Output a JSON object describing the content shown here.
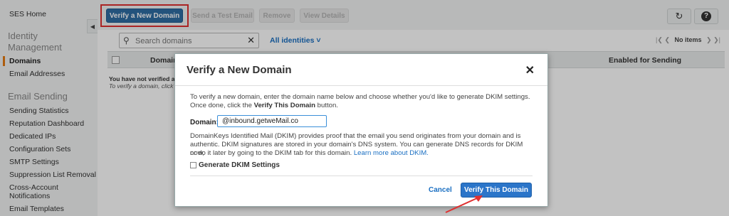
{
  "sidebar": {
    "home": "SES Home",
    "identity_heading_1": "Identity",
    "identity_heading_2": "Management",
    "identity_items": [
      "Domains",
      "Email Addresses"
    ],
    "email_heading": "Email Sending",
    "email_items": [
      "Sending Statistics",
      "Reputation Dashboard",
      "Dedicated IPs",
      "Configuration Sets",
      "SMTP Settings",
      "Suppression List Removal",
      "Cross-Account",
      "Notifications",
      "Email Templates"
    ],
    "collapse_icon": "chevron-left-icon"
  },
  "toolbar": {
    "verify_label": "Verify a New Domain",
    "test_email_label": "Send a Test Email",
    "remove_label": "Remove",
    "details_label": "View Details",
    "refresh_icon": "refresh-icon",
    "help_icon": "help-icon",
    "primary_color": "#2e6da4",
    "highlight_color": "#e03030"
  },
  "filter": {
    "search_placeholder": "Search domains",
    "identities_label": "All identities",
    "pager_text": "No items"
  },
  "table": {
    "col_domain": "Domain",
    "col_enabled": "Enabled for Sending",
    "empty_msg": "You have not verified any",
    "empty_hint": "To verify a domain, click t"
  },
  "modal": {
    "title": "Verify a New Domain",
    "intro_line1": "To verify a new domain, enter the domain name below and choose whether you'd like to generate DKIM settings.",
    "intro_line2_pre": "Once done, click the ",
    "intro_line2_bold": "Verify This Domain",
    "intro_line2_post": " button.",
    "domain_label": "Domain:",
    "domain_value": "@inbound.getweMail.co",
    "dkim_line1": "DomainKeys Identified Mail (DKIM) provides proof that the email you send originates from your domain and is",
    "dkim_line2": "authentic. DKIM signatures are stored in your domain's DNS system. You can generate DNS records for DKIM now,",
    "dkim_line3_pre": "or do it later by going to the DKIM tab for this domain. ",
    "dkim_link": "Learn more about DKIM.",
    "generate_label": "Generate DKIM Settings",
    "cancel_label": "Cancel",
    "verify_label": "Verify This Domain",
    "verify_color": "#2b75c9"
  }
}
